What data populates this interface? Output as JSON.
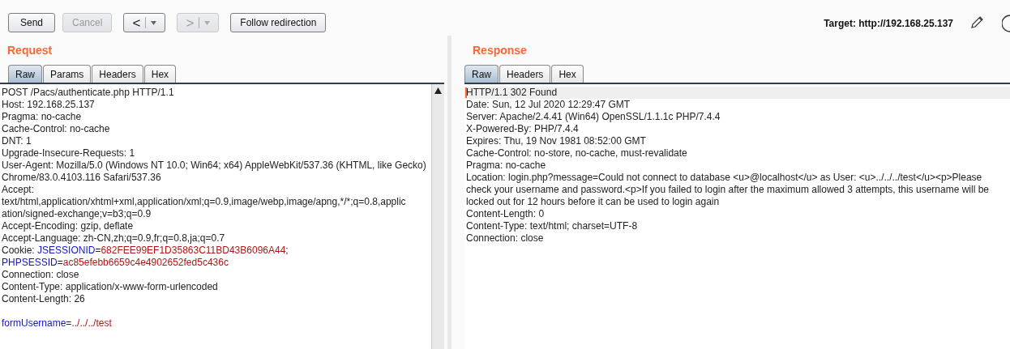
{
  "toolbar": {
    "buttons": [
      {
        "kind": "text",
        "label": "Send",
        "disabled": false
      },
      {
        "kind": "text",
        "label": "Cancel",
        "disabled": true
      },
      {
        "kind": "nav",
        "label": "<",
        "disabled": false
      },
      {
        "kind": "nav",
        "label": ">",
        "disabled": true
      },
      {
        "kind": "text",
        "label": "Follow redirection",
        "disabled": false
      }
    ],
    "target": "Target: http://192.168.25.137"
  },
  "request": {
    "title": "Request",
    "tabs": [
      {
        "label": "Raw",
        "selected": true
      },
      {
        "label": "Params",
        "selected": false
      },
      {
        "label": "Headers",
        "selected": false
      },
      {
        "label": "Hex",
        "selected": false
      }
    ],
    "headers": [
      {
        "text": "POST /Pacs/authenticate.php HTTP/1.1"
      },
      {
        "text": "Host: 192.168.25.137"
      },
      {
        "text": "Pragma: no-cache"
      },
      {
        "text": "Cache-Control: no-cache"
      },
      {
        "text": "DNT: 1"
      },
      {
        "text": "Upgrade-Insecure-Requests: 1"
      },
      {
        "text": "User-Agent: Mozilla/5.0 (Windows NT 10.0; Win64; x64) AppleWebKit/537.36 (KHTML, like Gecko)"
      },
      {
        "text": "Chrome/83.0.4103.116 Safari/537.36"
      },
      {
        "text": "Accept:"
      },
      {
        "text": "text/html,application/xhtml+xml,application/xml;q=0.9,image/webp,image/apng,*/*;q=0.8,applic"
      },
      {
        "text": "ation/signed-exchange;v=b3;q=0.9"
      },
      {
        "text": "Accept-Encoding: gzip, deflate"
      },
      {
        "text": "Accept-Language: zh-CN,zh;q=0.9,fr;q=0.8,ja;q=0.7"
      },
      {
        "segments": [
          {
            "kind": "plain",
            "text": "Cookie: "
          },
          {
            "kind": "name",
            "text": "JSESSIONID"
          },
          {
            "kind": "plain",
            "text": "="
          },
          {
            "kind": "value",
            "text": "682FEE99EF1D35863C11BD43B6096A44"
          },
          {
            "kind": "plain",
            "text": ";"
          }
        ]
      },
      {
        "segments": [
          {
            "kind": "name",
            "text": "PHPSESSID"
          },
          {
            "kind": "plain",
            "text": "="
          },
          {
            "kind": "value",
            "text": "ac85efebb6659c4e4902652fed5c436c"
          }
        ]
      },
      {
        "text": "Connection: close"
      },
      {
        "text": "Content-Type: application/x-www-form-urlencoded"
      },
      {
        "text": "Content-Length: 26"
      }
    ],
    "body": [
      {
        "segments": [
          {
            "kind": "name",
            "text": "formUsername"
          },
          {
            "kind": "plain",
            "text": "="
          },
          {
            "kind": "value",
            "text": "../../../test"
          }
        ]
      }
    ]
  },
  "response": {
    "title": "Response",
    "tabs": [
      {
        "label": "Raw",
        "selected": true
      },
      {
        "label": "Headers",
        "selected": false
      },
      {
        "label": "Hex",
        "selected": false
      }
    ],
    "lines": [
      {
        "text": "HTTP/1.1 302 Found",
        "current": true
      },
      {
        "text": "Date: Sun, 12 Jul 2020 12:29:47 GMT",
        "current": false
      },
      {
        "text": "Server: Apache/2.4.41 (Win64) OpenSSL/1.1.1c PHP/7.4.4",
        "current": false
      },
      {
        "text": "X-Powered-By: PHP/7.4.4",
        "current": false
      },
      {
        "text": "Expires: Thu, 19 Nov 1981 08:52:00 GMT",
        "current": false
      },
      {
        "text": "Cache-Control: no-store, no-cache, must-revalidate",
        "current": false
      },
      {
        "text": "Pragma: no-cache",
        "current": false
      },
      {
        "text": "Location: login.php?message=Could not connect to database <u>@localhost</u> as User: <u>../../../test</u><p>Please",
        "current": false
      },
      {
        "text": "check your username and password.<p>If you failed to login after the maximum allowed 3 attempts, this username will be",
        "current": false
      },
      {
        "text": "locked out for 12 hours before it can be used to login again",
        "current": false
      },
      {
        "text": "Content-Length: 0",
        "current": false
      },
      {
        "text": "Content-Type: text/html; charset=UTF-8",
        "current": false
      },
      {
        "text": "Connection: close",
        "current": false
      }
    ]
  }
}
